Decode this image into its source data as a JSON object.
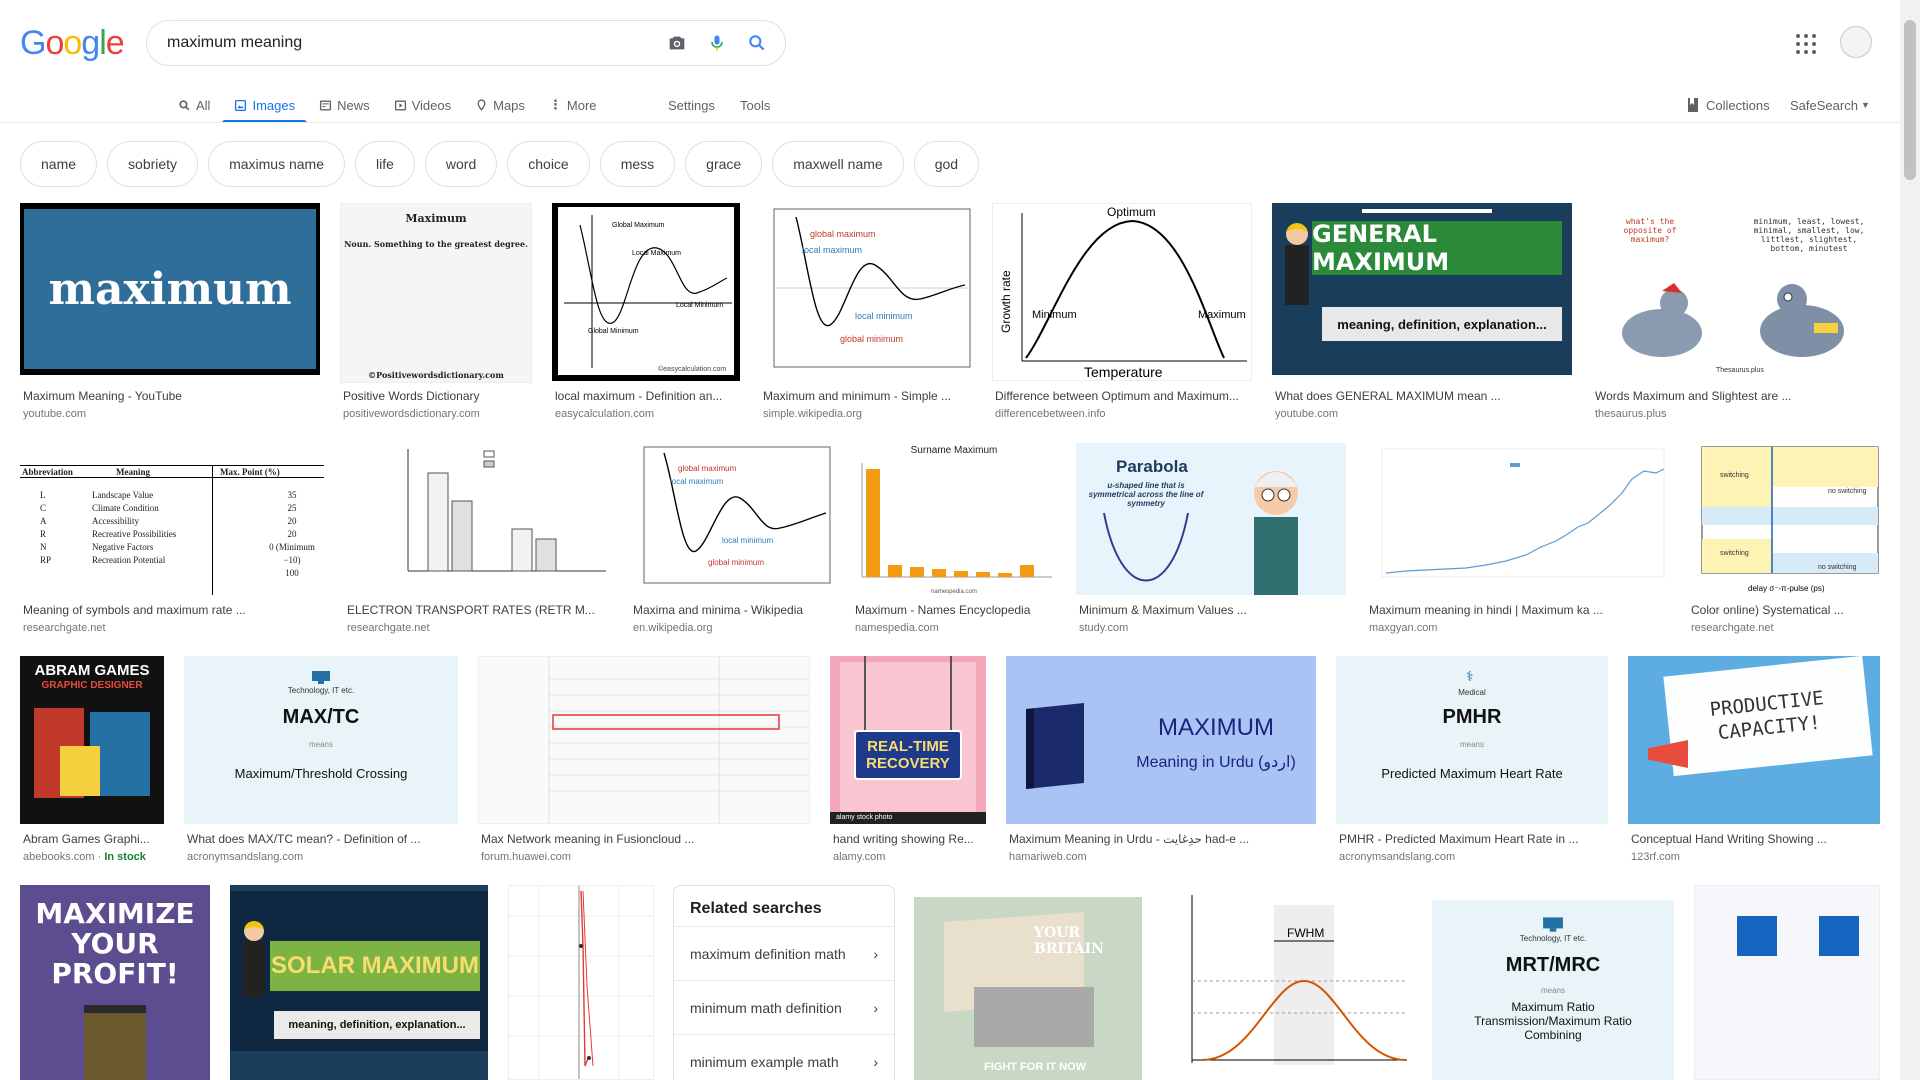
{
  "logo": {
    "letters": [
      "G",
      "o",
      "o",
      "g",
      "l",
      "e"
    ]
  },
  "search": {
    "value": "maximum meaning",
    "camera_icon": "camera-icon",
    "mic_icon": "mic-icon",
    "search_icon": "search-icon"
  },
  "tabs": [
    {
      "label": "All",
      "icon": "search-icon"
    },
    {
      "label": "Images",
      "icon": "image-icon"
    },
    {
      "label": "News",
      "icon": "news-icon"
    },
    {
      "label": "Videos",
      "icon": "video-icon"
    },
    {
      "label": "Maps",
      "icon": "map-icon"
    },
    {
      "label": "More",
      "icon": "more-dots-icon"
    }
  ],
  "settings_label": "Settings",
  "tools_label": "Tools",
  "collections_label": "Collections",
  "safesearch_label": "SafeSearch",
  "chips": [
    "name",
    "sobriety",
    "maximus name",
    "life",
    "word",
    "choice",
    "mess",
    "grace",
    "maxwell name",
    "god"
  ],
  "row1": [
    {
      "caption": "Maximum Meaning - YouTube",
      "source": "youtube.com",
      "thumb_text": "maximum"
    },
    {
      "caption": "Positive Words Dictionary",
      "source": "positivewordsdictionary.com",
      "thumb_text": "Maximum"
    },
    {
      "caption": "local maximum - Definition an...",
      "source": "easycalculation.com",
      "thumb_text": ""
    },
    {
      "caption": "Maximum and minimum - Simple ...",
      "source": "simple.wikipedia.org",
      "thumb_text": ""
    },
    {
      "caption": "Difference between Optimum and Maximum...",
      "source": "differencebetween.info",
      "thumb_text": "Optimum"
    },
    {
      "caption": "What does GENERAL MAXIMUM mean ...",
      "source": "youtube.com",
      "thumb_text": "GENERAL MAXIMUM"
    },
    {
      "caption": "Words Maximum and Slightest are ...",
      "source": "thesaurus.plus",
      "thumb_text": ""
    }
  ],
  "row2": [
    {
      "caption": "Meaning of symbols and maximum rate ...",
      "source": "researchgate.net",
      "thumb_text": "Abbreviation"
    },
    {
      "caption": "ELECTRON TRANSPORT RATES (RETR M...",
      "source": "researchgate.net",
      "thumb_text": ""
    },
    {
      "caption": "Maxima and minima - Wikipedia",
      "source": "en.wikipedia.org",
      "thumb_text": ""
    },
    {
      "caption": "Maximum - Names Encyclopedia",
      "source": "namespedia.com",
      "thumb_text": "Surname Maximum"
    },
    {
      "caption": "Minimum & Maximum Values ...",
      "source": "study.com",
      "thumb_text": "Parabola"
    },
    {
      "caption": "Maximum meaning in hindi | Maximum ka ...",
      "source": "maxgyan.com",
      "thumb_text": ""
    },
    {
      "caption": "Color online) Systematical ...",
      "source": "researchgate.net",
      "thumb_text": ""
    }
  ],
  "row3": [
    {
      "caption": "Abram Games Graphi...",
      "source": "abebooks.com",
      "badge": "In stock",
      "thumb_text": "ABRAM GAMES"
    },
    {
      "caption": "What does MAX/TC mean? - Definition of ...",
      "source": "acronymsandslang.com",
      "thumb_text": "MAX/TC"
    },
    {
      "caption": "Max Network meaning in Fusioncloud ...",
      "source": "forum.huawei.com",
      "thumb_text": ""
    },
    {
      "caption": "hand writing showing Re...",
      "source": "alamy.com",
      "thumb_text": "REAL-TIME RECOVERY"
    },
    {
      "caption": "Maximum Meaning in Urdu - حدِغایت had-e ...",
      "source": "hamariweb.com",
      "thumb_text": "MAXIMUM"
    },
    {
      "caption": "PMHR - Predicted Maximum Heart Rate in ...",
      "source": "acronymsandslang.com",
      "thumb_text": "PMHR"
    },
    {
      "caption": "Conceptual Hand Writing Showing ...",
      "source": "123rf.com",
      "thumb_text": "PRODUCTIVE CAPACITY!"
    }
  ],
  "row4": [
    {
      "thumb_text": "MAXIMIZE YOUR PROFIT!"
    },
    {
      "thumb_text": "SOLAR MAXIMUM"
    },
    {
      "thumb_text": ""
    },
    {
      "thumb_text": "YOUR BRITAIN"
    },
    {
      "thumb_text": "FWHM"
    },
    {
      "thumb_text": "MRT/MRC"
    },
    {
      "thumb_text": ""
    }
  ],
  "related": {
    "title": "Related searches",
    "items": [
      "maximum definition math",
      "minimum math definition",
      "minimum example math"
    ]
  },
  "thumb_texts": {
    "positive_sub": "Noun. Something to the greatest degree.",
    "positive_foot": "©Positivewordsdictionary.com",
    "easycalc_foot": "©easycalculation.com",
    "global_maximum": "Global Maximum",
    "local_maximum": "Local Maximum",
    "local_minimum": "Local Minimum",
    "global_minimum": "Global Minimum",
    "wiki_global_max": "global maximum",
    "wiki_local_max": "local maximum",
    "wiki_local_min": "local minimum",
    "wiki_global_min": "global minimum",
    "growth_rate": "Growth rate",
    "temperature": "Temperature",
    "minimum": "Minimum",
    "maximum": "Maximum",
    "meaning_def": "meaning, definition, explanation...",
    "thesaurus_q": "what's the opposite of maximum?",
    "thesaurus_a": "minimum, least, lowest, minimal, smallest, low, littlest, slightest, bottom, minutest",
    "thesaurus_foot": "Thesaurus.plus",
    "table_headers": [
      "Abbreviation",
      "Meaning",
      "Max. Point (%)"
    ],
    "table_rows": [
      [
        "L",
        "Landscape Value",
        "35"
      ],
      [
        "C",
        "Climate Condition",
        "25"
      ],
      [
        "A",
        "Accessibility",
        "20"
      ],
      [
        "R",
        "Recreative Possibilities",
        "20"
      ],
      [
        "N",
        "Negative Factors",
        "0 (Minimum −10)"
      ],
      [
        "RP",
        "Recreation Potential",
        "100"
      ]
    ],
    "parabola_sub": "u-shaped line that is symmetrical across the line of symmetry",
    "tech_it": "Technology, IT etc.",
    "medical": "Medical",
    "means": "means",
    "maxtc_full": "Maximum/Threshold Crossing",
    "pmhr_full": "Predicted Maximum Heart Rate",
    "mrt_full": "Maximum Ratio Transmission/Maximum Ratio Combining",
    "urdu_sub": "Meaning in Urdu (اردو)",
    "fight": "FIGHT FOR IT NOW",
    "abram_sub": "GRAPHIC DESIGNER",
    "alamy": "alamy stock photo",
    "namespedia": "namespedia.com",
    "pulse_label": "delay σ⁻-π-pulse (ps)",
    "switching": "switching",
    "no_switching": "no switching"
  },
  "colors": {
    "accent": "#1a73e8",
    "caption": "#3c4043",
    "source": "#70757a",
    "in_stock": "#188038"
  }
}
